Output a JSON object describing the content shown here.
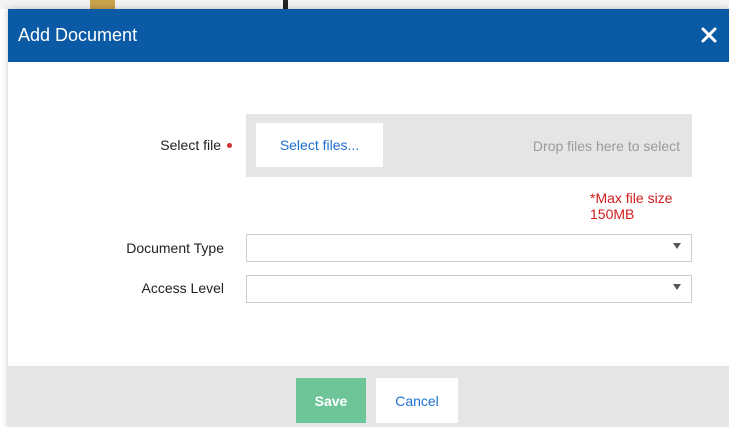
{
  "dialog": {
    "title": "Add Document",
    "close_icon": "close-icon"
  },
  "form": {
    "select_file_label": "Select file",
    "select_files_button": "Select files...",
    "drop_hint": "Drop files here to select",
    "max_size_note": "*Max file size 150MB",
    "document_type_label": "Document Type",
    "document_type_value": "",
    "access_level_label": "Access Level",
    "access_level_value": ""
  },
  "footer": {
    "save_label": "Save",
    "cancel_label": "Cancel"
  },
  "colors": {
    "titlebar": "#0b5aa5",
    "save_button": "#6cc497",
    "link_blue": "#1c6fd0",
    "required_red": "#d21c1c",
    "dropzone_bg": "#e4e5e7"
  }
}
